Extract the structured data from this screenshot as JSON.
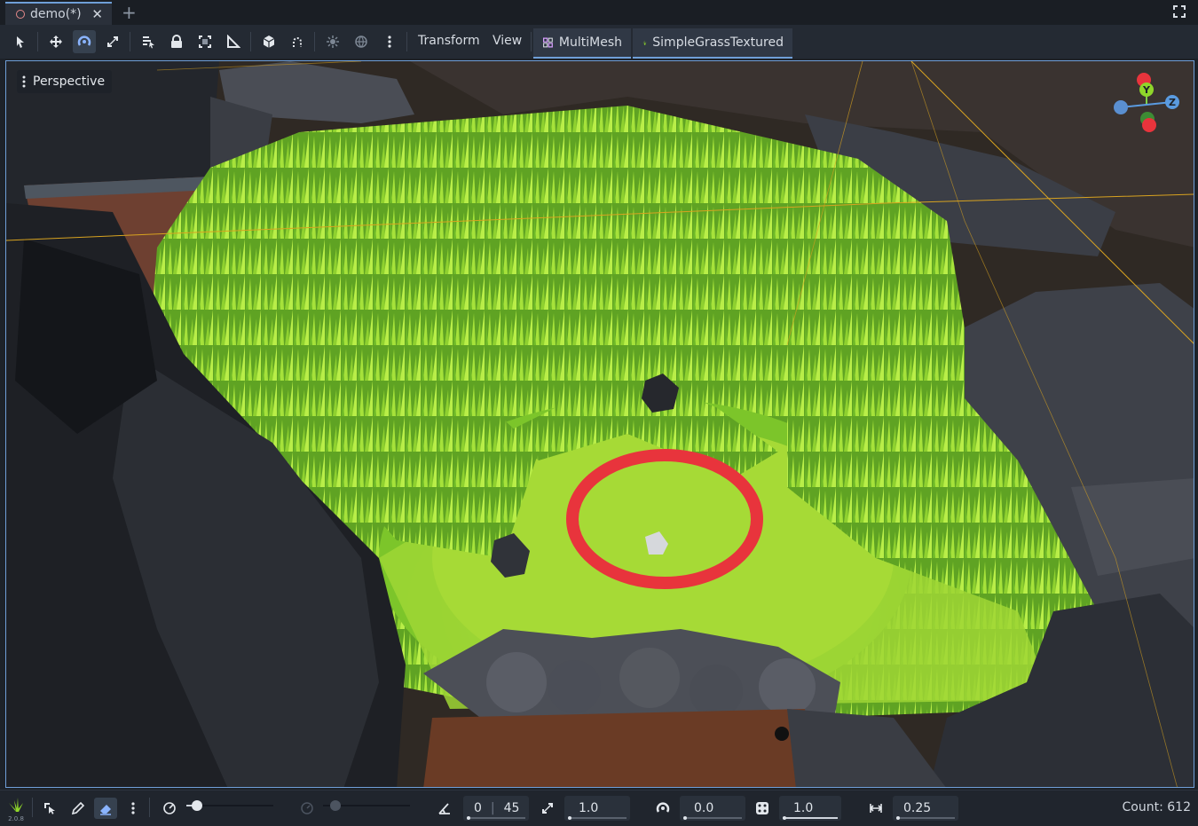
{
  "tabs": {
    "active_label": "demo(*)"
  },
  "toolbar": {
    "menus": [
      "Transform",
      "View"
    ],
    "multimesh_label": "MultiMesh",
    "grass_label": "SimpleGrassTextured"
  },
  "viewport": {
    "perspective_label": "Perspective",
    "gizmo": {
      "y": "Y",
      "z": "Z"
    }
  },
  "bottom": {
    "plugin_version": "2.0.8",
    "angle_min": "0",
    "angle_max": "45",
    "scale": "1.0",
    "rotation": "0.0",
    "random": "1.0",
    "distance": "0.25",
    "count_label": "Count: 612"
  },
  "colors": {
    "accent": "#6f9fd8",
    "brush": "#e8343c",
    "grass": "#8fd62a",
    "rock": "#3d4048"
  }
}
